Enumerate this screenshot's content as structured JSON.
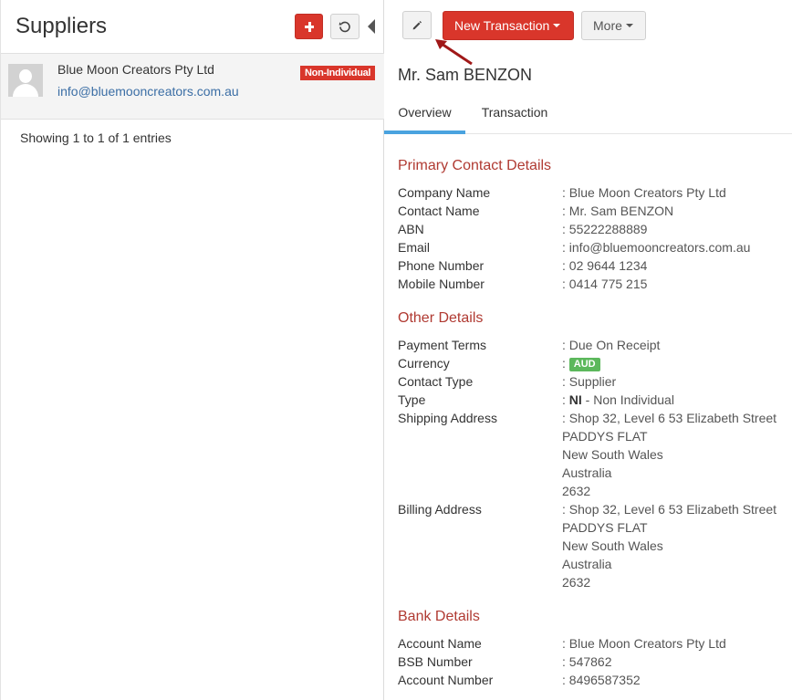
{
  "left": {
    "title": "Suppliers",
    "supplier": {
      "name": "Blue Moon Creators Pty Ltd",
      "email": "info@bluemooncreators.com.au",
      "badge": "Non-Individual"
    },
    "showing": "Showing 1 to 1 of 1 entries"
  },
  "toolbar": {
    "new_transaction": "New Transaction",
    "more": "More"
  },
  "contact_name": "Mr. Sam BENZON",
  "tabs": [
    "Overview",
    "Transaction"
  ],
  "primary": {
    "title": "Primary Contact Details",
    "company_name_label": "Company Name",
    "company_name": ": Blue Moon Creators Pty Ltd",
    "contact_name_label": "Contact Name",
    "contact_name": ": Mr. Sam BENZON",
    "abn_label": "ABN",
    "abn": ": 55222288889",
    "email_label": "Email",
    "email": ": info@bluemooncreators.com.au",
    "phone_label": "Phone Number",
    "phone": ": 02 9644 1234",
    "mobile_label": "Mobile Number",
    "mobile": ": 0414 775 215"
  },
  "other": {
    "title": "Other Details",
    "payment_terms_label": "Payment Terms",
    "payment_terms": ": Due On Receipt",
    "currency_label": "Currency",
    "currency_prefix": ":",
    "currency": "AUD",
    "contact_type_label": "Contact Type",
    "contact_type": ": Supplier",
    "type_label": "Type",
    "type_prefix": ":",
    "type_code": "NI",
    "type_text": "- Non Individual",
    "shipping_label": "Shipping Address",
    "shipping": [
      ": Shop 32, Level 6 53 Elizabeth Street",
      "PADDYS FLAT",
      "New South Wales",
      "Australia",
      "2632"
    ],
    "billing_label": "Billing Address",
    "billing": [
      ": Shop 32, Level 6 53 Elizabeth Street",
      "PADDYS FLAT",
      "New South Wales",
      "Australia",
      "2632"
    ]
  },
  "bank": {
    "title": "Bank Details",
    "account_name_label": "Account Name",
    "account_name": ": Blue Moon Creators Pty Ltd",
    "bsb_label": "BSB Number",
    "bsb": ": 547862",
    "account_number_label": "Account Number",
    "account_number": ": 8496587352"
  },
  "colors": {
    "accent_red": "#d9362b",
    "section_title": "#b03a32",
    "tab_active": "#4aa3df",
    "currency_badge": "#5cb85c",
    "link": "#3b6ea5",
    "annotation_arrow": "#a01818"
  },
  "icons": {
    "add": "plus-icon",
    "refresh": "refresh-icon",
    "collapse": "caret-left-icon",
    "edit": "pencil-icon",
    "avatar": "user-silhouette-icon"
  }
}
